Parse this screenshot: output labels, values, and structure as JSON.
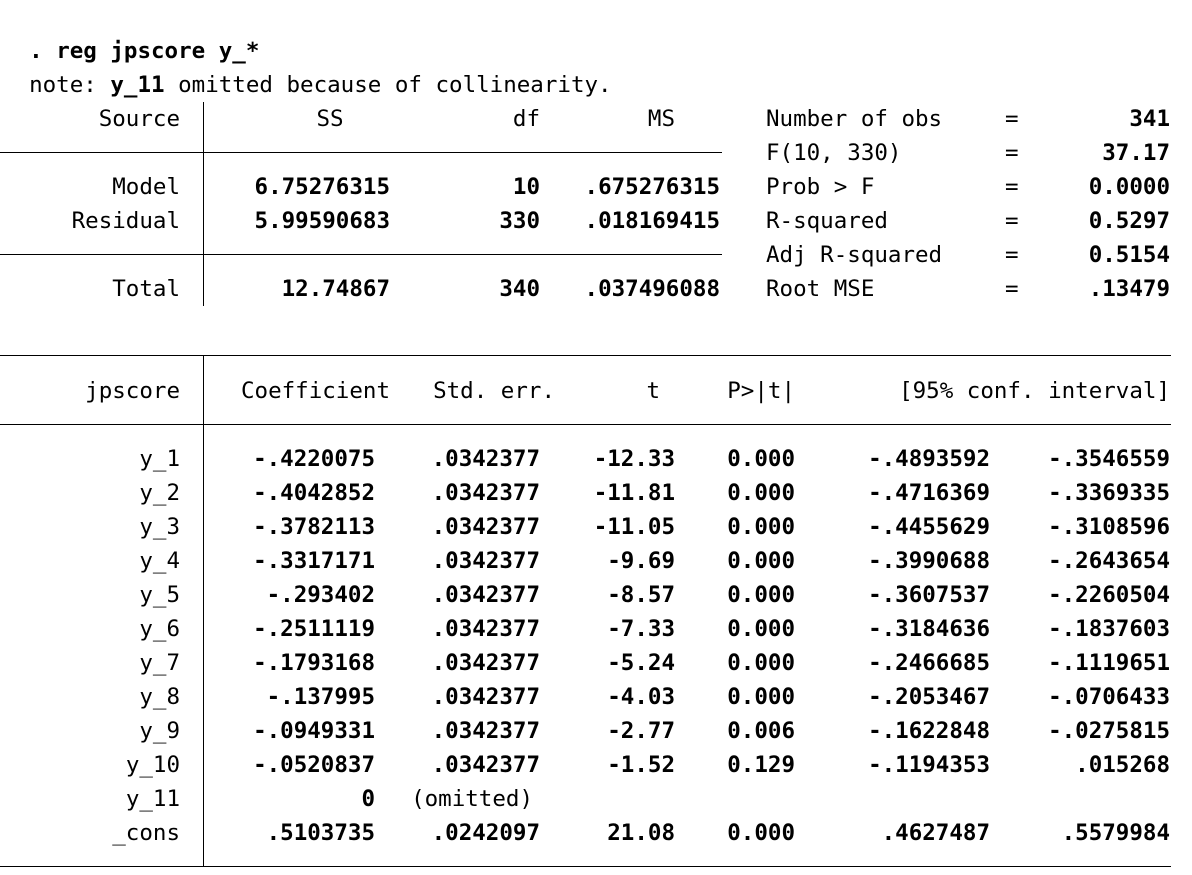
{
  "command": {
    "prompt": ".",
    "text": "reg jpscore y_*"
  },
  "note": {
    "prefix": "note:",
    "var": "y_11",
    "suffix": "omitted because of collinearity."
  },
  "anova": {
    "headers": {
      "source": "Source",
      "ss": "SS",
      "df": "df",
      "ms": "MS"
    },
    "rows": [
      {
        "source": "Model",
        "ss": "6.75276315",
        "df": "10",
        "ms": ".675276315"
      },
      {
        "source": "Residual",
        "ss": "5.99590683",
        "df": "330",
        "ms": ".018169415"
      },
      {
        "source": "Total",
        "ss": "12.74867",
        "df": "340",
        "ms": ".037496088"
      }
    ]
  },
  "stats": [
    {
      "label": "Number of obs",
      "eq": "=",
      "value": "341"
    },
    {
      "label": "F(10, 330)",
      "eq": "=",
      "value": "37.17"
    },
    {
      "label": "Prob > F",
      "eq": "=",
      "value": "0.0000"
    },
    {
      "label": "R-squared",
      "eq": "=",
      "value": "0.5297"
    },
    {
      "label": "Adj R-squared",
      "eq": "=",
      "value": "0.5154"
    },
    {
      "label": "Root MSE",
      "eq": "=",
      "value": ".13479"
    }
  ],
  "coef": {
    "headers": {
      "depvar": "jpscore",
      "coef": "Coefficient",
      "se": "Std. err.",
      "t": "t",
      "p": "P>|t|",
      "ci": "[95% conf. interval]"
    },
    "rows": [
      {
        "var": "y_1",
        "coef": "-.4220075",
        "se": ".0342377",
        "t": "-12.33",
        "p": "0.000",
        "lo": "-.4893592",
        "hi": "-.3546559"
      },
      {
        "var": "y_2",
        "coef": "-.4042852",
        "se": ".0342377",
        "t": "-11.81",
        "p": "0.000",
        "lo": "-.4716369",
        "hi": "-.3369335"
      },
      {
        "var": "y_3",
        "coef": "-.3782113",
        "se": ".0342377",
        "t": "-11.05",
        "p": "0.000",
        "lo": "-.4455629",
        "hi": "-.3108596"
      },
      {
        "var": "y_4",
        "coef": "-.3317171",
        "se": ".0342377",
        "t": "-9.69",
        "p": "0.000",
        "lo": "-.3990688",
        "hi": "-.2643654"
      },
      {
        "var": "y_5",
        "coef": "-.293402",
        "se": ".0342377",
        "t": "-8.57",
        "p": "0.000",
        "lo": "-.3607537",
        "hi": "-.2260504"
      },
      {
        "var": "y_6",
        "coef": "-.2511119",
        "se": ".0342377",
        "t": "-7.33",
        "p": "0.000",
        "lo": "-.3184636",
        "hi": "-.1837603"
      },
      {
        "var": "y_7",
        "coef": "-.1793168",
        "se": ".0342377",
        "t": "-5.24",
        "p": "0.000",
        "lo": "-.2466685",
        "hi": "-.1119651"
      },
      {
        "var": "y_8",
        "coef": "-.137995",
        "se": ".0342377",
        "t": "-4.03",
        "p": "0.000",
        "lo": "-.2053467",
        "hi": "-.0706433"
      },
      {
        "var": "y_9",
        "coef": "-.0949331",
        "se": ".0342377",
        "t": "-2.77",
        "p": "0.006",
        "lo": "-.1622848",
        "hi": "-.0275815"
      },
      {
        "var": "y_10",
        "coef": "-.0520837",
        "se": ".0342377",
        "t": "-1.52",
        "p": "0.129",
        "lo": "-.1194353",
        "hi": ".015268"
      },
      {
        "var": "y_11",
        "coef": "0",
        "se": "(omitted)",
        "t": "",
        "p": "",
        "lo": "",
        "hi": ""
      },
      {
        "var": "_cons",
        "coef": ".5103735",
        "se": ".0242097",
        "t": "21.08",
        "p": "0.000",
        "lo": ".4627487",
        "hi": ".5579984"
      }
    ]
  }
}
